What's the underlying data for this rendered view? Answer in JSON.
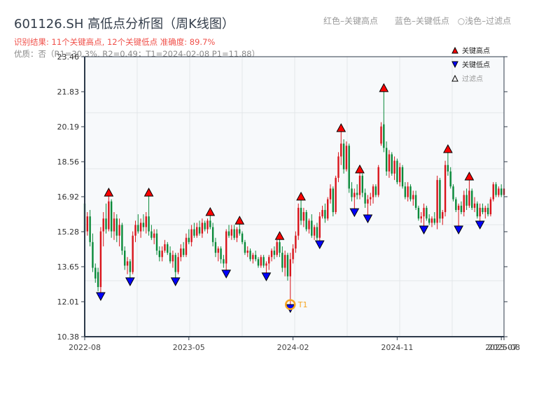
{
  "header": {
    "title": "601126.SH 高低点分析图（周K线图）",
    "result": "识别结果: 11个关键高点, 12个关键低点   准确度: 89.7%",
    "quality": "优质：否（R1=30.3%, R2=0.49；T1=2024-02-08 P1=11.88）",
    "legend_red": "红色–关键高点",
    "legend_blue": "蓝色–关键低点",
    "legend_light": "○浅色–过滤点"
  },
  "chart_data": {
    "type": "candlestick",
    "ylim": [
      10.38,
      23.46
    ],
    "yticks": [
      "23.46",
      "21.83",
      "20.19",
      "18.56",
      "16.92",
      "15.28",
      "13.65",
      "12.01",
      "10.38"
    ],
    "xticks": [
      {
        "index": 0,
        "label": "2022-08"
      },
      {
        "index": 39,
        "label": "2023-05"
      },
      {
        "index": 78,
        "label": "2024-02"
      },
      {
        "index": 117,
        "label": "2024-11"
      },
      {
        "index": 156,
        "label": "2025-07"
      },
      {
        "index": 157,
        "label": "2025-08"
      }
    ],
    "grid": true,
    "legend": {
      "placement": "top-right",
      "entries": [
        "关键高点",
        "关键低点",
        "过滤点"
      ]
    },
    "colors": {
      "up": "#d9141b",
      "down": "#0a8a3a",
      "high_marker": "#ff0000",
      "low_marker": "#0000ff",
      "t1": "#f5a623",
      "plot_bg": "#f7f9fb"
    },
    "ohlc": [
      [
        16.6,
        16.9,
        15.0,
        15.3
      ],
      [
        15.3,
        16.2,
        15.1,
        16.0
      ],
      [
        16.0,
        16.3,
        14.6,
        14.8
      ],
      [
        14.8,
        15.2,
        13.4,
        13.6
      ],
      [
        13.6,
        13.8,
        12.9,
        13.1
      ],
      [
        13.4,
        13.6,
        12.5,
        12.7
      ],
      [
        12.7,
        15.5,
        12.44,
        15.3
      ],
      [
        15.3,
        16.2,
        14.6,
        15.9
      ],
      [
        15.9,
        16.6,
        15.2,
        15.4
      ],
      [
        15.4,
        16.95,
        15.3,
        16.7
      ],
      [
        16.7,
        16.8,
        15.0,
        15.3
      ],
      [
        15.3,
        16.2,
        14.9,
        15.9
      ],
      [
        15.9,
        16.1,
        14.8,
        15.1
      ],
      [
        15.1,
        15.9,
        14.6,
        15.6
      ],
      [
        15.6,
        15.7,
        14.2,
        14.4
      ],
      [
        14.4,
        14.6,
        13.5,
        13.7
      ],
      [
        13.7,
        14.1,
        13.3,
        13.9
      ],
      [
        13.9,
        14.0,
        13.13,
        13.4
      ],
      [
        13.4,
        15.3,
        13.3,
        15.1
      ],
      [
        15.1,
        15.8,
        14.8,
        15.6
      ],
      [
        15.6,
        16.1,
        15.2,
        15.3
      ],
      [
        15.3,
        15.9,
        15.0,
        15.7
      ],
      [
        15.7,
        16.1,
        15.3,
        15.5
      ],
      [
        15.5,
        16.2,
        15.2,
        16.0
      ],
      [
        16.0,
        16.95,
        15.1,
        15.3
      ],
      [
        15.3,
        15.6,
        14.9,
        15.0
      ],
      [
        15.0,
        15.4,
        14.7,
        15.2
      ],
      [
        15.2,
        15.4,
        14.2,
        14.4
      ],
      [
        14.4,
        14.6,
        13.9,
        14.1
      ],
      [
        14.1,
        14.6,
        13.9,
        14.4
      ],
      [
        14.4,
        14.9,
        14.3,
        14.7
      ],
      [
        14.7,
        14.8,
        14.2,
        14.3
      ],
      [
        14.3,
        14.6,
        13.8,
        13.9
      ],
      [
        13.9,
        14.4,
        13.6,
        14.2
      ],
      [
        14.2,
        14.3,
        13.13,
        13.4
      ],
      [
        13.4,
        14.3,
        13.3,
        14.1
      ],
      [
        14.1,
        14.7,
        13.9,
        14.5
      ],
      [
        14.5,
        14.8,
        14.1,
        14.2
      ],
      [
        14.2,
        15.2,
        14.1,
        15.0
      ],
      [
        15.0,
        15.4,
        14.7,
        14.8
      ],
      [
        14.8,
        15.6,
        14.6,
        15.4
      ],
      [
        15.4,
        15.7,
        15.0,
        15.1
      ],
      [
        15.1,
        15.7,
        15.0,
        15.5
      ],
      [
        15.5,
        15.8,
        15.1,
        15.2
      ],
      [
        15.2,
        15.9,
        15.0,
        15.7
      ],
      [
        15.7,
        15.8,
        15.3,
        15.4
      ],
      [
        15.4,
        15.9,
        15.2,
        15.8
      ],
      [
        15.8,
        16.04,
        15.4,
        15.5
      ],
      [
        15.5,
        15.7,
        14.6,
        14.8
      ],
      [
        14.8,
        15.0,
        14.1,
        14.3
      ],
      [
        14.3,
        14.6,
        13.9,
        14.5
      ],
      [
        14.5,
        14.6,
        13.8,
        14.0
      ],
      [
        14.0,
        14.2,
        13.6,
        13.8
      ],
      [
        13.8,
        15.4,
        13.49,
        15.3
      ],
      [
        15.3,
        15.6,
        15.0,
        15.1
      ],
      [
        15.1,
        15.6,
        14.9,
        15.4
      ],
      [
        15.4,
        15.6,
        14.9,
        15.0
      ],
      [
        15.0,
        15.5,
        14.8,
        15.4
      ],
      [
        15.4,
        15.64,
        15.1,
        15.2
      ],
      [
        15.2,
        15.3,
        14.7,
        14.8
      ],
      [
        14.8,
        14.9,
        14.2,
        14.3
      ],
      [
        14.3,
        14.6,
        14.1,
        14.4
      ],
      [
        14.4,
        14.5,
        13.9,
        14.0
      ],
      [
        14.0,
        14.3,
        13.8,
        14.2
      ],
      [
        14.2,
        14.4,
        13.9,
        14.0
      ],
      [
        14.0,
        14.1,
        13.6,
        13.7
      ],
      [
        13.7,
        14.2,
        13.6,
        14.1
      ],
      [
        14.1,
        14.2,
        13.6,
        13.7
      ],
      [
        13.7,
        13.9,
        13.36,
        13.8
      ],
      [
        13.8,
        14.2,
        13.5,
        14.1
      ],
      [
        14.1,
        14.5,
        13.9,
        14.4
      ],
      [
        14.4,
        14.6,
        14.0,
        14.2
      ],
      [
        14.2,
        14.9,
        14.1,
        14.8
      ],
      [
        14.8,
        14.92,
        14.1,
        14.3
      ],
      [
        14.3,
        14.6,
        13.4,
        13.6
      ],
      [
        13.6,
        14.4,
        13.2,
        14.2
      ],
      [
        14.2,
        14.3,
        13.0,
        13.2
      ],
      [
        13.2,
        14.3,
        11.88,
        14.0
      ],
      [
        14.0,
        14.7,
        13.8,
        14.5
      ],
      [
        14.5,
        15.3,
        14.3,
        15.1
      ],
      [
        15.1,
        16.6,
        14.9,
        16.4
      ],
      [
        16.4,
        16.76,
        15.6,
        15.8
      ],
      [
        15.8,
        16.4,
        15.5,
        16.2
      ],
      [
        16.2,
        16.3,
        15.3,
        15.4
      ],
      [
        15.4,
        15.9,
        15.2,
        15.8
      ],
      [
        15.8,
        16.1,
        15.0,
        15.1
      ],
      [
        15.1,
        15.6,
        14.9,
        15.5
      ],
      [
        15.5,
        15.7,
        14.9,
        15.0
      ],
      [
        15.0,
        16.2,
        14.86,
        16.0
      ],
      [
        16.0,
        16.5,
        15.9,
        16.3
      ],
      [
        16.3,
        16.6,
        15.7,
        15.9
      ],
      [
        15.9,
        16.9,
        15.8,
        16.8
      ],
      [
        16.8,
        17.5,
        16.6,
        17.3
      ],
      [
        17.3,
        17.4,
        16.0,
        16.2
      ],
      [
        16.2,
        17.9,
        16.1,
        17.8
      ],
      [
        17.8,
        19.0,
        17.6,
        18.8
      ],
      [
        18.8,
        19.96,
        18.4,
        19.4
      ],
      [
        19.4,
        19.6,
        18.0,
        18.2
      ],
      [
        18.2,
        19.5,
        18.1,
        19.3
      ],
      [
        19.3,
        19.4,
        17.1,
        17.3
      ],
      [
        17.3,
        17.6,
        16.7,
        16.9
      ],
      [
        16.9,
        17.3,
        16.36,
        17.1
      ],
      [
        17.1,
        17.5,
        16.8,
        17.0
      ],
      [
        17.0,
        18.03,
        16.8,
        17.9
      ],
      [
        17.9,
        18.0,
        16.9,
        17.1
      ],
      [
        17.1,
        17.3,
        16.4,
        16.6
      ],
      [
        16.6,
        17.0,
        16.07,
        16.8
      ],
      [
        16.8,
        17.1,
        16.5,
        16.9
      ],
      [
        16.9,
        17.5,
        16.6,
        17.4
      ],
      [
        17.4,
        17.5,
        16.9,
        17.0
      ],
      [
        17.0,
        18.4,
        16.9,
        18.3
      ],
      [
        19.4,
        20.4,
        19.3,
        20.2
      ],
      [
        20.3,
        21.83,
        19.0,
        19.2
      ],
      [
        19.2,
        19.5,
        17.9,
        18.1
      ],
      [
        18.1,
        19.1,
        17.8,
        18.9
      ],
      [
        18.9,
        19.0,
        17.9,
        18.0
      ],
      [
        18.0,
        18.8,
        17.7,
        18.6
      ],
      [
        18.6,
        18.7,
        17.5,
        17.6
      ],
      [
        17.6,
        18.5,
        17.4,
        18.3
      ],
      [
        18.3,
        18.4,
        17.3,
        17.4
      ],
      [
        17.4,
        17.6,
        16.8,
        16.9
      ],
      [
        16.9,
        17.6,
        16.7,
        17.4
      ],
      [
        17.4,
        17.5,
        16.7,
        16.8
      ],
      [
        16.8,
        17.2,
        16.5,
        17.0
      ],
      [
        17.0,
        17.2,
        16.3,
        16.4
      ],
      [
        16.4,
        16.5,
        15.8,
        15.9
      ],
      [
        15.9,
        16.2,
        15.7,
        16.0
      ],
      [
        16.0,
        16.6,
        15.55,
        16.4
      ],
      [
        16.4,
        16.5,
        15.8,
        15.9
      ],
      [
        15.9,
        16.1,
        15.6,
        15.7
      ],
      [
        15.7,
        16.0,
        15.5,
        15.9
      ],
      [
        15.9,
        16.2,
        15.6,
        15.7
      ],
      [
        15.7,
        17.9,
        15.4,
        17.7
      ],
      [
        17.7,
        17.8,
        15.7,
        15.9
      ],
      [
        15.9,
        16.3,
        15.6,
        16.2
      ],
      [
        16.2,
        18.6,
        16.0,
        18.4
      ],
      [
        18.4,
        18.98,
        17.9,
        18.1
      ],
      [
        18.1,
        18.3,
        17.3,
        17.4
      ],
      [
        17.4,
        17.5,
        16.7,
        16.8
      ],
      [
        16.8,
        16.9,
        16.2,
        16.3
      ],
      [
        16.3,
        16.6,
        15.55,
        16.5
      ],
      [
        16.5,
        16.7,
        16.1,
        16.2
      ],
      [
        16.2,
        17.2,
        16.0,
        17.0
      ],
      [
        17.0,
        17.3,
        16.3,
        16.5
      ],
      [
        16.5,
        17.7,
        16.4,
        17.2
      ],
      [
        17.2,
        17.3,
        16.3,
        16.4
      ],
      [
        16.4,
        16.9,
        16.2,
        16.6
      ],
      [
        16.6,
        16.7,
        15.9,
        16.0
      ],
      [
        16.0,
        16.6,
        15.78,
        16.4
      ],
      [
        16.4,
        16.6,
        16.1,
        16.2
      ],
      [
        16.2,
        16.5,
        15.9,
        16.4
      ],
      [
        16.4,
        16.6,
        16.0,
        16.1
      ],
      [
        16.1,
        16.9,
        16.0,
        16.8
      ],
      [
        16.8,
        17.6,
        16.7,
        17.5
      ],
      [
        17.5,
        17.6,
        16.9,
        17.0
      ],
      [
        17.0,
        17.4,
        16.9,
        17.3
      ],
      [
        17.3,
        17.5,
        16.9,
        17.0
      ],
      [
        17.0,
        17.4,
        16.9,
        17.3
      ]
    ],
    "key_highs": [
      9,
      24,
      47,
      58,
      73,
      81,
      96,
      103,
      112,
      136,
      144
    ],
    "key_lows": [
      6,
      17,
      34,
      53,
      68,
      77,
      88,
      101,
      106,
      127,
      140,
      148
    ],
    "t1": {
      "index": 77,
      "label": "T1",
      "date": "2024-02-08",
      "price": 11.88
    }
  }
}
